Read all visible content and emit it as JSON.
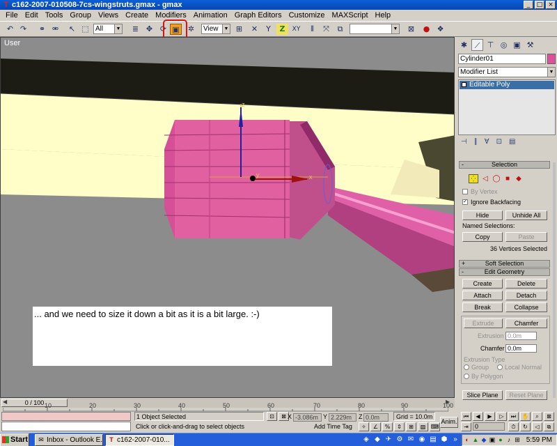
{
  "window": {
    "title": "c162-2007-010508-7cs-wingstruts.gmax - gmax"
  },
  "menu": [
    "File",
    "Edit",
    "Tools",
    "Group",
    "Views",
    "Create",
    "Modifiers",
    "Animation",
    "Graph Editors",
    "Customize",
    "MAXScript",
    "Help"
  ],
  "toolbar": {
    "filter": "All",
    "ref_coord": "View",
    "axis_z": "Z",
    "axis_xy": "XY"
  },
  "viewport": {
    "label": "User",
    "axis_x": "x",
    "axis_y": "y",
    "axis_z": "z"
  },
  "caption": "... and we need to size it down a bit as it is a bit large. :-)",
  "command_panel": {
    "object_name": "Cylinder01",
    "modifier_list": "Modifier List",
    "stack_item": "Editable Poly",
    "selection": {
      "title": "Selection",
      "by_vertex": "By Vertex",
      "ignore_backfacing": "Ignore Backfacing",
      "hide": "Hide",
      "unhide_all": "Unhide All",
      "named_selections": "Named Selections:",
      "copy": "Copy",
      "paste": "Paste",
      "status": "36 Vertices Selected"
    },
    "soft_selection": "Soft Selection",
    "edit_geometry": {
      "title": "Edit Geometry",
      "create": "Create",
      "delete": "Delete",
      "attach": "Attach",
      "detach": "Detach",
      "break": "Break",
      "collapse": "Collapse",
      "extrude": "Extrude",
      "chamfer": "Chamfer",
      "extrusion_label": "Extrusion",
      "extrusion_value": "0.0m",
      "chamfer_label": "Chamfer",
      "chamfer_value": "0.0m",
      "extrusion_type": "Extrusion Type",
      "group": "Group",
      "local_normal": "Local Normal",
      "by_polygon": "By Polygon",
      "slice_plane": "Slice Plane",
      "reset_plane": "Reset Plane"
    }
  },
  "timeline": {
    "frame": "0 / 100",
    "ticks": [
      "10",
      "20",
      "30",
      "40",
      "50",
      "60",
      "70",
      "80",
      "90",
      "100"
    ]
  },
  "status": {
    "selection": "1 Object Selected",
    "prompt": "Click or click-and-drag to select objects",
    "x_label": "X",
    "x_value": "-3.086m",
    "y_label": "Y",
    "y_value": "2.229m",
    "z_label": "Z",
    "z_value": "0.0m",
    "grid": "Grid = 10.0m",
    "add_time_tag": "Add Time Tag",
    "anim": "Anim.",
    "frame_value": "0"
  },
  "taskbar": {
    "start": "Start",
    "tasks": [
      "Inbox - Outlook E...",
      "c162-2007-010..."
    ],
    "clock": "5:59 PM"
  }
}
